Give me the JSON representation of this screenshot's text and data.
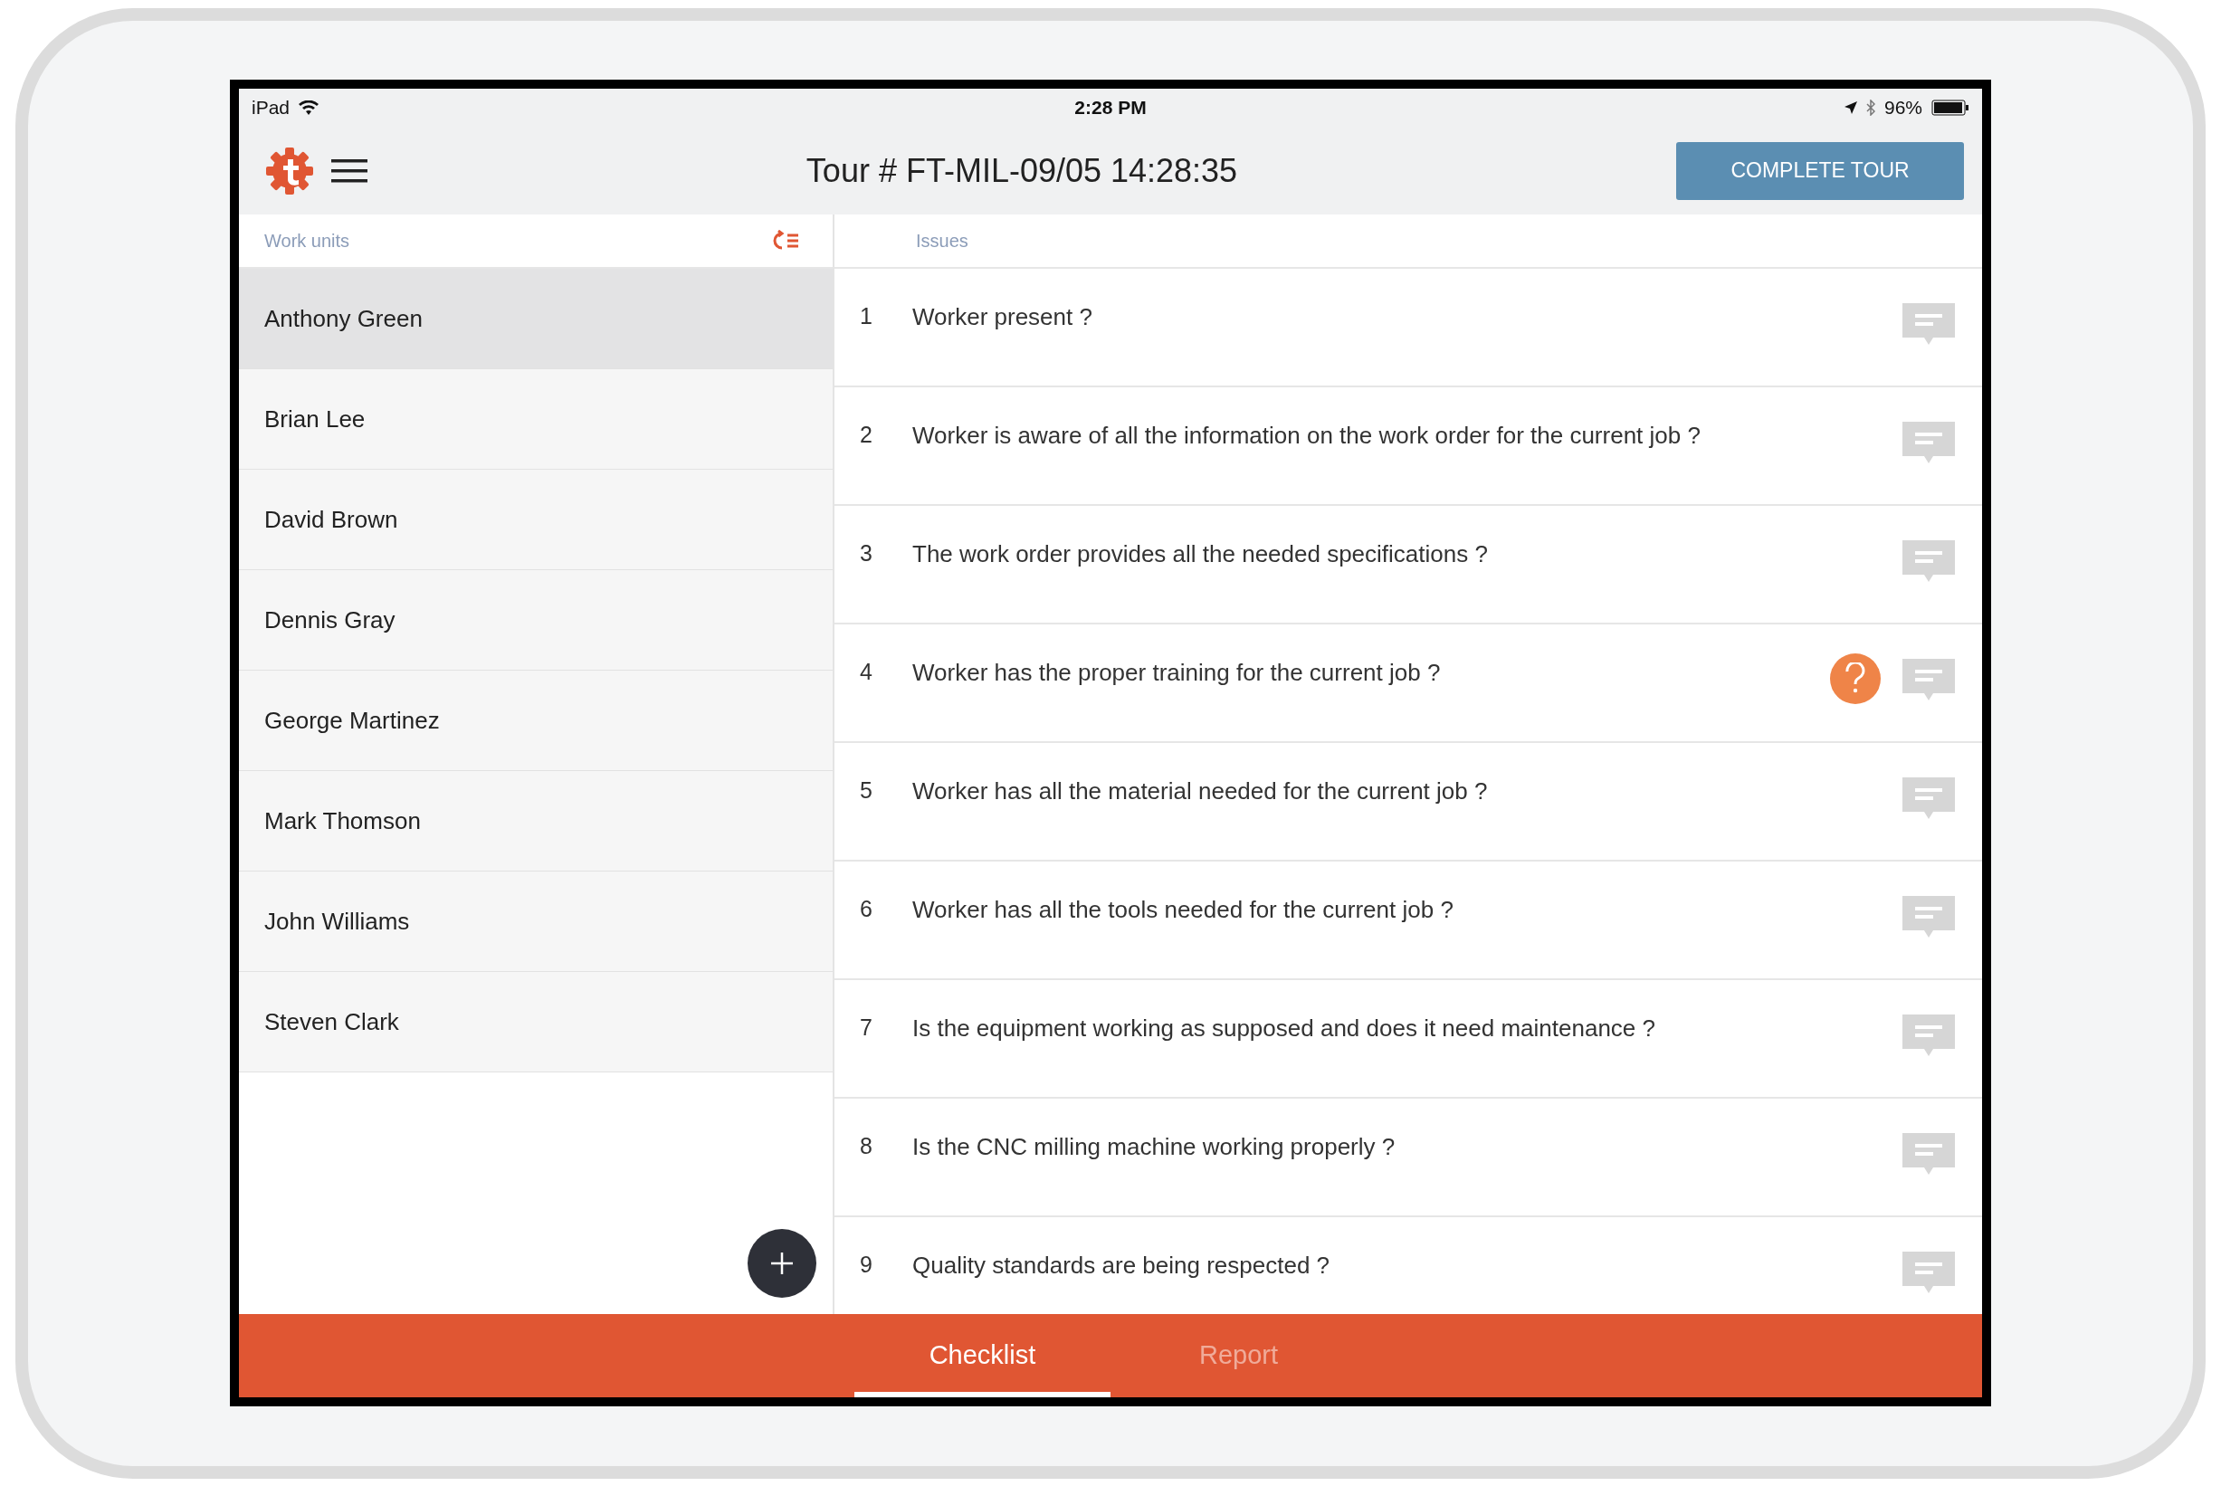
{
  "status_bar": {
    "device": "iPad",
    "time": "2:28 PM",
    "battery": "96%"
  },
  "header": {
    "title": "Tour # FT-MIL-09/05 14:28:35",
    "action": "COMPLETE TOUR"
  },
  "work_units": {
    "heading": "Work units",
    "items": [
      {
        "name": "Anthony Green",
        "selected": true
      },
      {
        "name": "Brian Lee",
        "selected": false
      },
      {
        "name": "David Brown",
        "selected": false
      },
      {
        "name": "Dennis Gray",
        "selected": false
      },
      {
        "name": "George Martinez",
        "selected": false
      },
      {
        "name": "Mark Thomson",
        "selected": false
      },
      {
        "name": "John Williams",
        "selected": false
      },
      {
        "name": "Steven Clark",
        "selected": false
      }
    ]
  },
  "issues": {
    "heading": "Issues",
    "items": [
      {
        "number": "1",
        "text": "Worker present ?",
        "flagged": false
      },
      {
        "number": "2",
        "text": "Worker is aware of all the information on the work order for the current job ?",
        "flagged": false
      },
      {
        "number": "3",
        "text": "The work order provides all the needed specifications ?",
        "flagged": false
      },
      {
        "number": "4",
        "text": "Worker has the proper training for the current job ?",
        "flagged": true
      },
      {
        "number": "5",
        "text": "Worker has all the material needed for the current job ?",
        "flagged": false
      },
      {
        "number": "6",
        "text": "Worker has all the tools needed for the current job ?",
        "flagged": false
      },
      {
        "number": "7",
        "text": "Is the equipment working as supposed and does it need maintenance ?",
        "flagged": false
      },
      {
        "number": "8",
        "text": "Is the CNC milling machine working properly ?",
        "flagged": false
      },
      {
        "number": "9",
        "text": "Quality standards are being respected ?",
        "flagged": false
      }
    ]
  },
  "bottom_tabs": [
    {
      "label": "Checklist",
      "selected": true
    },
    {
      "label": "Report",
      "selected": false
    }
  ]
}
